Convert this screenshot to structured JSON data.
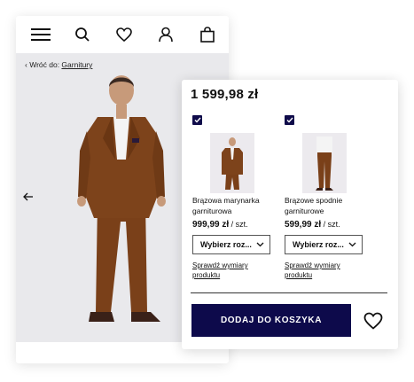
{
  "header": {
    "icons": [
      "menu-icon",
      "search-icon",
      "heart-icon",
      "user-icon",
      "bag-icon"
    ]
  },
  "breadcrumb": {
    "prefix": "Wróć do: ",
    "link": "Garnitury"
  },
  "set": {
    "total_price": "1 599,98 zł",
    "items": [
      {
        "name": "Brązowa marynarka garniturowa",
        "price": "999,99 zł",
        "unit": " / szt.",
        "select_label": "Wybierz roz...",
        "sizes_link": "Sprawdź wymiary produktu",
        "checked": true
      },
      {
        "name": "Brązowe spodnie garniturowe",
        "price": "599,99 zł",
        "unit": " / szt.",
        "select_label": "Wybierz roz...",
        "sizes_link": "Sprawdź wymiary produktu",
        "checked": true
      }
    ],
    "add_to_cart": "DODAJ DO KOSZYKA"
  },
  "colors": {
    "brand_navy": "#0d0a4b",
    "suit_brown": "#7a4019"
  }
}
